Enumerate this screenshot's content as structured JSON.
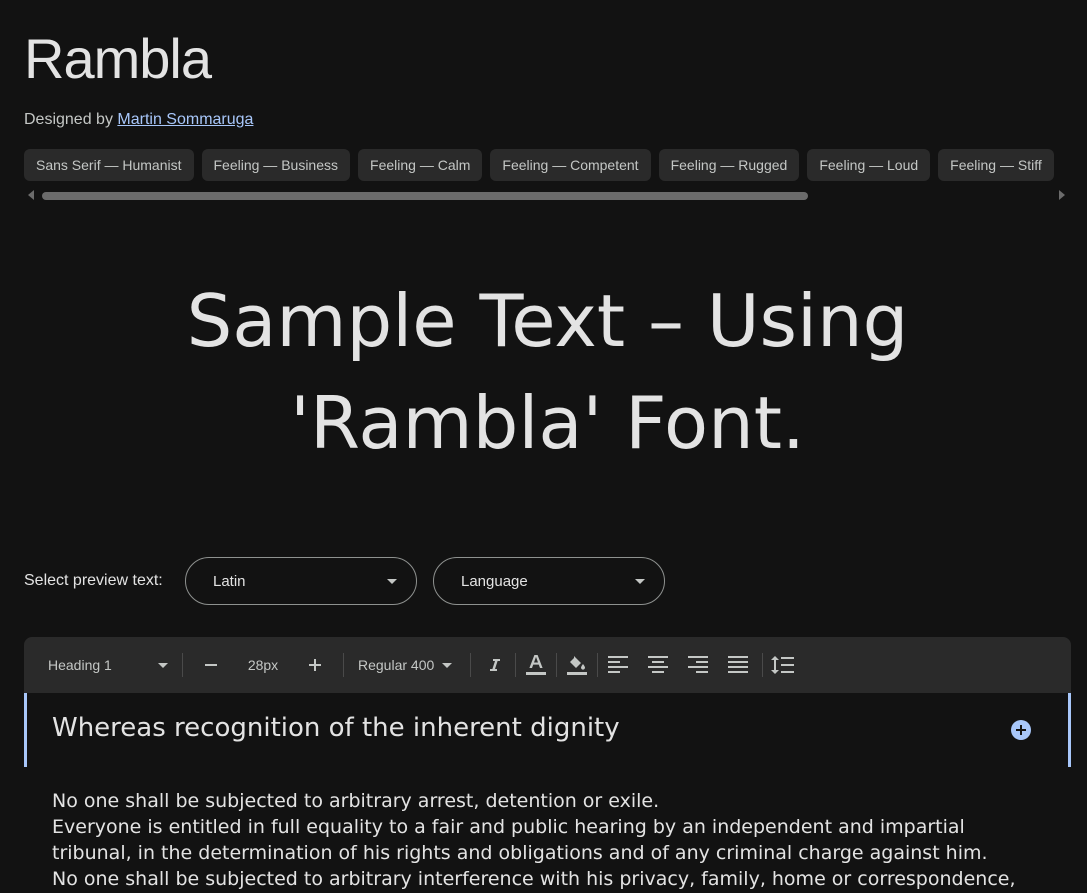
{
  "font": {
    "name": "Rambla",
    "designer_prefix": "Designed by",
    "designer_name": "Martin Sommaruga"
  },
  "tags": [
    "Sans Serif — Humanist",
    "Feeling — Business",
    "Feeling — Calm",
    "Feeling — Competent",
    "Feeling — Rugged",
    "Feeling — Loud",
    "Feeling — Stiff"
  ],
  "sample_text": "Sample Text – Using 'Rambla' Font.",
  "preview": {
    "label": "Select preview text:",
    "script_value": "Latin",
    "language_value": "Language"
  },
  "toolbar": {
    "style_value": "Heading 1",
    "size_value": "28px",
    "weight_value": "Regular 400"
  },
  "editor": {
    "heading_line": "Whereas recognition of the inherent dignity",
    "body_lines": [
      "No one shall be subjected to arbitrary arrest, detention or exile.",
      "Everyone is entitled in full equality to a fair and public hearing by an independent and impartial",
      "tribunal, in the determination of his rights and obligations and of any criminal charge against him.",
      "No one shall be subjected to arbitrary interference with his privacy, family, home or correspondence,"
    ]
  },
  "colors": {
    "background": "#121212",
    "accent": "#a8c7fa",
    "chip": "#2a2a2a"
  }
}
